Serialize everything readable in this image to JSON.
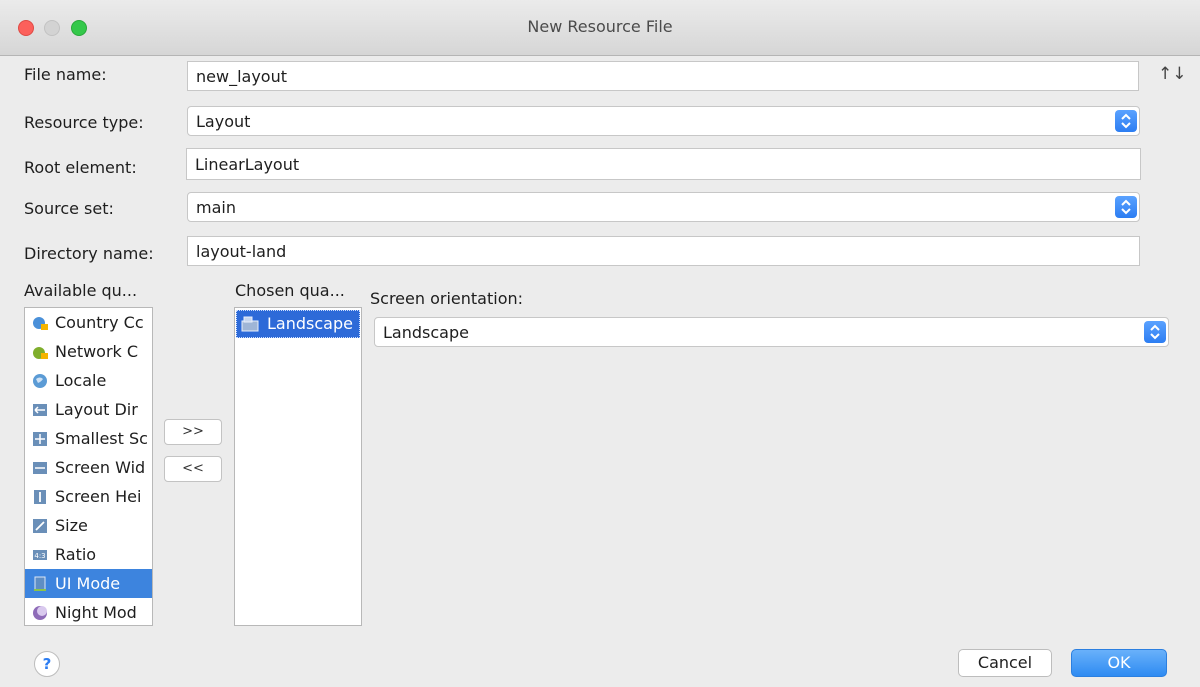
{
  "window": {
    "title": "New Resource File"
  },
  "form": {
    "file_name_label": "File name:",
    "file_name_value": "new_layout",
    "resource_type_label": "Resource type:",
    "resource_type_value": "Layout",
    "root_element_label": "Root element:",
    "root_element_value": "LinearLayout",
    "source_set_label": "Source set:",
    "source_set_value": "main",
    "directory_name_label": "Directory name:",
    "directory_name_value": "layout-land",
    "sort_icon": "↑↓"
  },
  "available": {
    "label": "Available qu...",
    "items": [
      {
        "label": "Country Cc",
        "icon": "country-code-icon"
      },
      {
        "label": "Network C",
        "icon": "network-code-icon"
      },
      {
        "label": "Locale",
        "icon": "globe-icon"
      },
      {
        "label": "Layout Dir",
        "icon": "layout-direction-icon"
      },
      {
        "label": "Smallest Sc",
        "icon": "smallest-screen-icon"
      },
      {
        "label": "Screen Wid",
        "icon": "screen-width-icon"
      },
      {
        "label": "Screen Hei",
        "icon": "screen-height-icon"
      },
      {
        "label": "Size",
        "icon": "size-icon"
      },
      {
        "label": "Ratio",
        "icon": "ratio-icon"
      },
      {
        "label": "UI Mode",
        "icon": "ui-mode-icon"
      },
      {
        "label": "Night Mod",
        "icon": "night-mode-icon"
      }
    ],
    "selected_index": 9
  },
  "buttons": {
    "add": ">>",
    "remove": "<<",
    "help": "?",
    "cancel": "Cancel",
    "ok": "OK"
  },
  "chosen": {
    "label": "Chosen qua...",
    "items": [
      {
        "label": "Landscape",
        "icon": "landscape-icon"
      }
    ]
  },
  "orientation": {
    "label": "Screen orientation:",
    "value": "Landscape"
  },
  "colors": {
    "accent": "#2c7df2",
    "selection": "#3d84de"
  }
}
